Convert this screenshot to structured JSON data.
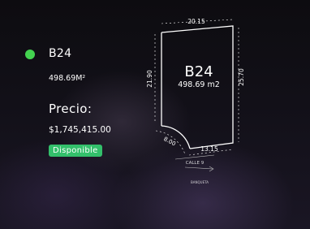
{
  "lot": {
    "id": "B24",
    "area": "498.69M²",
    "price_label": "Precio:",
    "price": "$1,745,415.00",
    "status": "Disponible"
  },
  "plan": {
    "title": "B24",
    "area": "498.69 m2",
    "dim_top": "20.15",
    "dim_right": "25.70",
    "dim_left": "21.90",
    "dim_bottom": "13.15",
    "dim_arc": "8.00",
    "street": "CALLE 9",
    "sidewalk": "BANQUETA"
  },
  "colors": {
    "status_dot": "#43d24f",
    "badge": "#33c06b"
  }
}
